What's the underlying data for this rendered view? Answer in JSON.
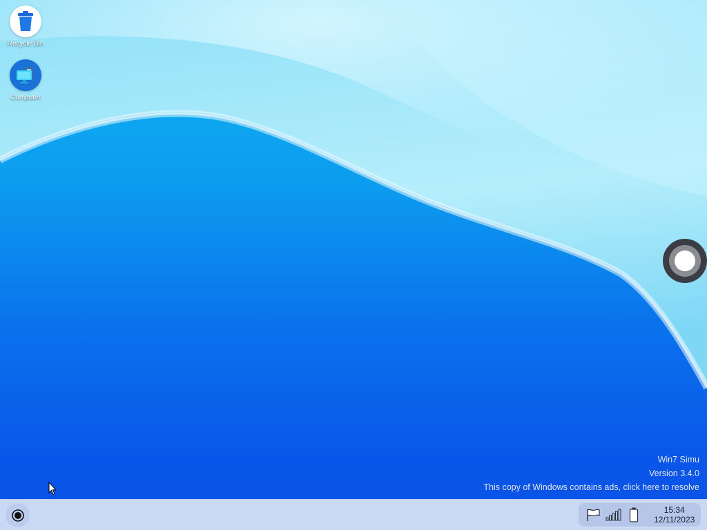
{
  "desktop": {
    "icons": [
      {
        "label": "Recycle Bin",
        "icon": "recycle-bin-icon"
      },
      {
        "label": "Computer",
        "icon": "computer-icon"
      }
    ],
    "watermark": {
      "line1": "Win7 Simu",
      "line2": "Version 3.4.0",
      "line3": "This copy of Windows contains ads, click here to resolve"
    }
  },
  "taskbar": {
    "start_icon": "start-orb-icon",
    "tray": {
      "icons": [
        "flag-icon",
        "signal-icon",
        "battery-icon"
      ],
      "time": "15:34",
      "date": "12/11/2023"
    }
  },
  "colors": {
    "wallpaper_top": "#0fb6f2",
    "wallpaper_bottom": "#0a50e6",
    "taskbar": "#c9d8f3",
    "tray": "#b5c6e8"
  }
}
